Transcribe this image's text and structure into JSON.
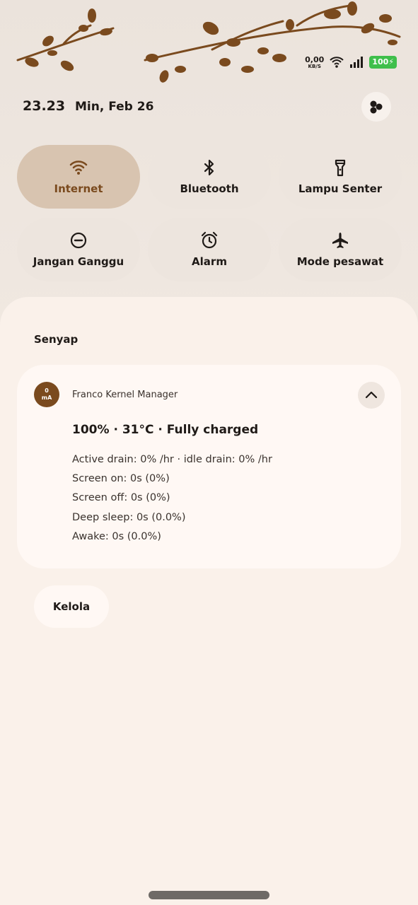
{
  "status_bar": {
    "net_speed_value": "0,00",
    "net_speed_unit": "KB/S",
    "battery": "100"
  },
  "header": {
    "time": "23.23",
    "date": "Min, Feb 26"
  },
  "tiles": [
    {
      "label": "Internet",
      "icon": "wifi-icon",
      "active": true
    },
    {
      "label": "Bluetooth",
      "icon": "bluetooth-icon",
      "active": false
    },
    {
      "label": "Lampu Senter",
      "icon": "flashlight-icon",
      "active": false
    },
    {
      "label": "Jangan Ganggu",
      "icon": "do-not-disturb-icon",
      "active": false
    },
    {
      "label": "Alarm",
      "icon": "alarm-icon",
      "active": false
    },
    {
      "label": "Mode pesawat",
      "icon": "airplane-icon",
      "active": false
    }
  ],
  "notifications": {
    "section_title": "Senyap",
    "card": {
      "icon_text_top": "0",
      "icon_text_bottom": "mA",
      "app_name": "Franco Kernel Manager",
      "title": "100% · 31°C · Fully charged",
      "lines": [
        "Active drain: 0% /hr · idle drain: 0% /hr",
        "Screen on: 0s (0%)",
        "Screen off: 0s (0%)",
        "Deep sleep: 0s (0.0%)",
        "Awake: 0s (0.0%)"
      ]
    },
    "manage_label": "Kelola"
  },
  "colors": {
    "accent": "#7a4a1e",
    "active_tile": "#d8c4b0",
    "battery": "#3fbf4b"
  }
}
